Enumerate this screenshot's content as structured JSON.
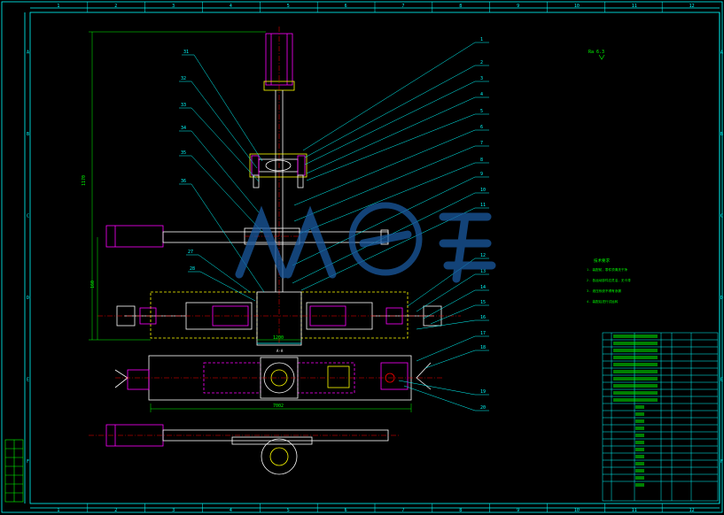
{
  "drawing": {
    "column_labels": [
      "1",
      "2",
      "3",
      "4",
      "5",
      "6",
      "7",
      "8",
      "9",
      "10",
      "11",
      "12"
    ],
    "row_labels": [
      "A",
      "B",
      "C",
      "D",
      "E",
      "F"
    ],
    "left_callouts": [
      "31",
      "32",
      "33",
      "34",
      "35",
      "36",
      "27",
      "28"
    ],
    "right_callouts": [
      "1",
      "2",
      "3",
      "4",
      "5",
      "6",
      "7",
      "8",
      "9",
      "10",
      "11",
      "12",
      "13",
      "14",
      "15",
      "16",
      "17",
      "18",
      "19",
      "20"
    ],
    "dimensions": {
      "total_height": "1170",
      "lower_height": "160",
      "center_width": "1200",
      "overall_width": "7002"
    },
    "roughness_note": "Ra 6.3",
    "tech_requirements_title": "技术要求",
    "tech_requirements": [
      "1. 装配前，零件须清洗干净",
      "2. 各运动部件应灵活，无卡滞",
      "3. 液压系统不得有渗漏",
      "4. 装配后进行试运转"
    ],
    "section_label": "A-A",
    "watermark": "人人文库"
  },
  "colors": {
    "frame": "#00ffff",
    "part_outline": "#ffffff",
    "hatch_yellow": "#ffff00",
    "hydraulic_magenta": "#ff00ff",
    "dimension_green": "#00ff00",
    "leader_cyan": "#00ffff",
    "watermark_blue": "#1a5aa0"
  }
}
